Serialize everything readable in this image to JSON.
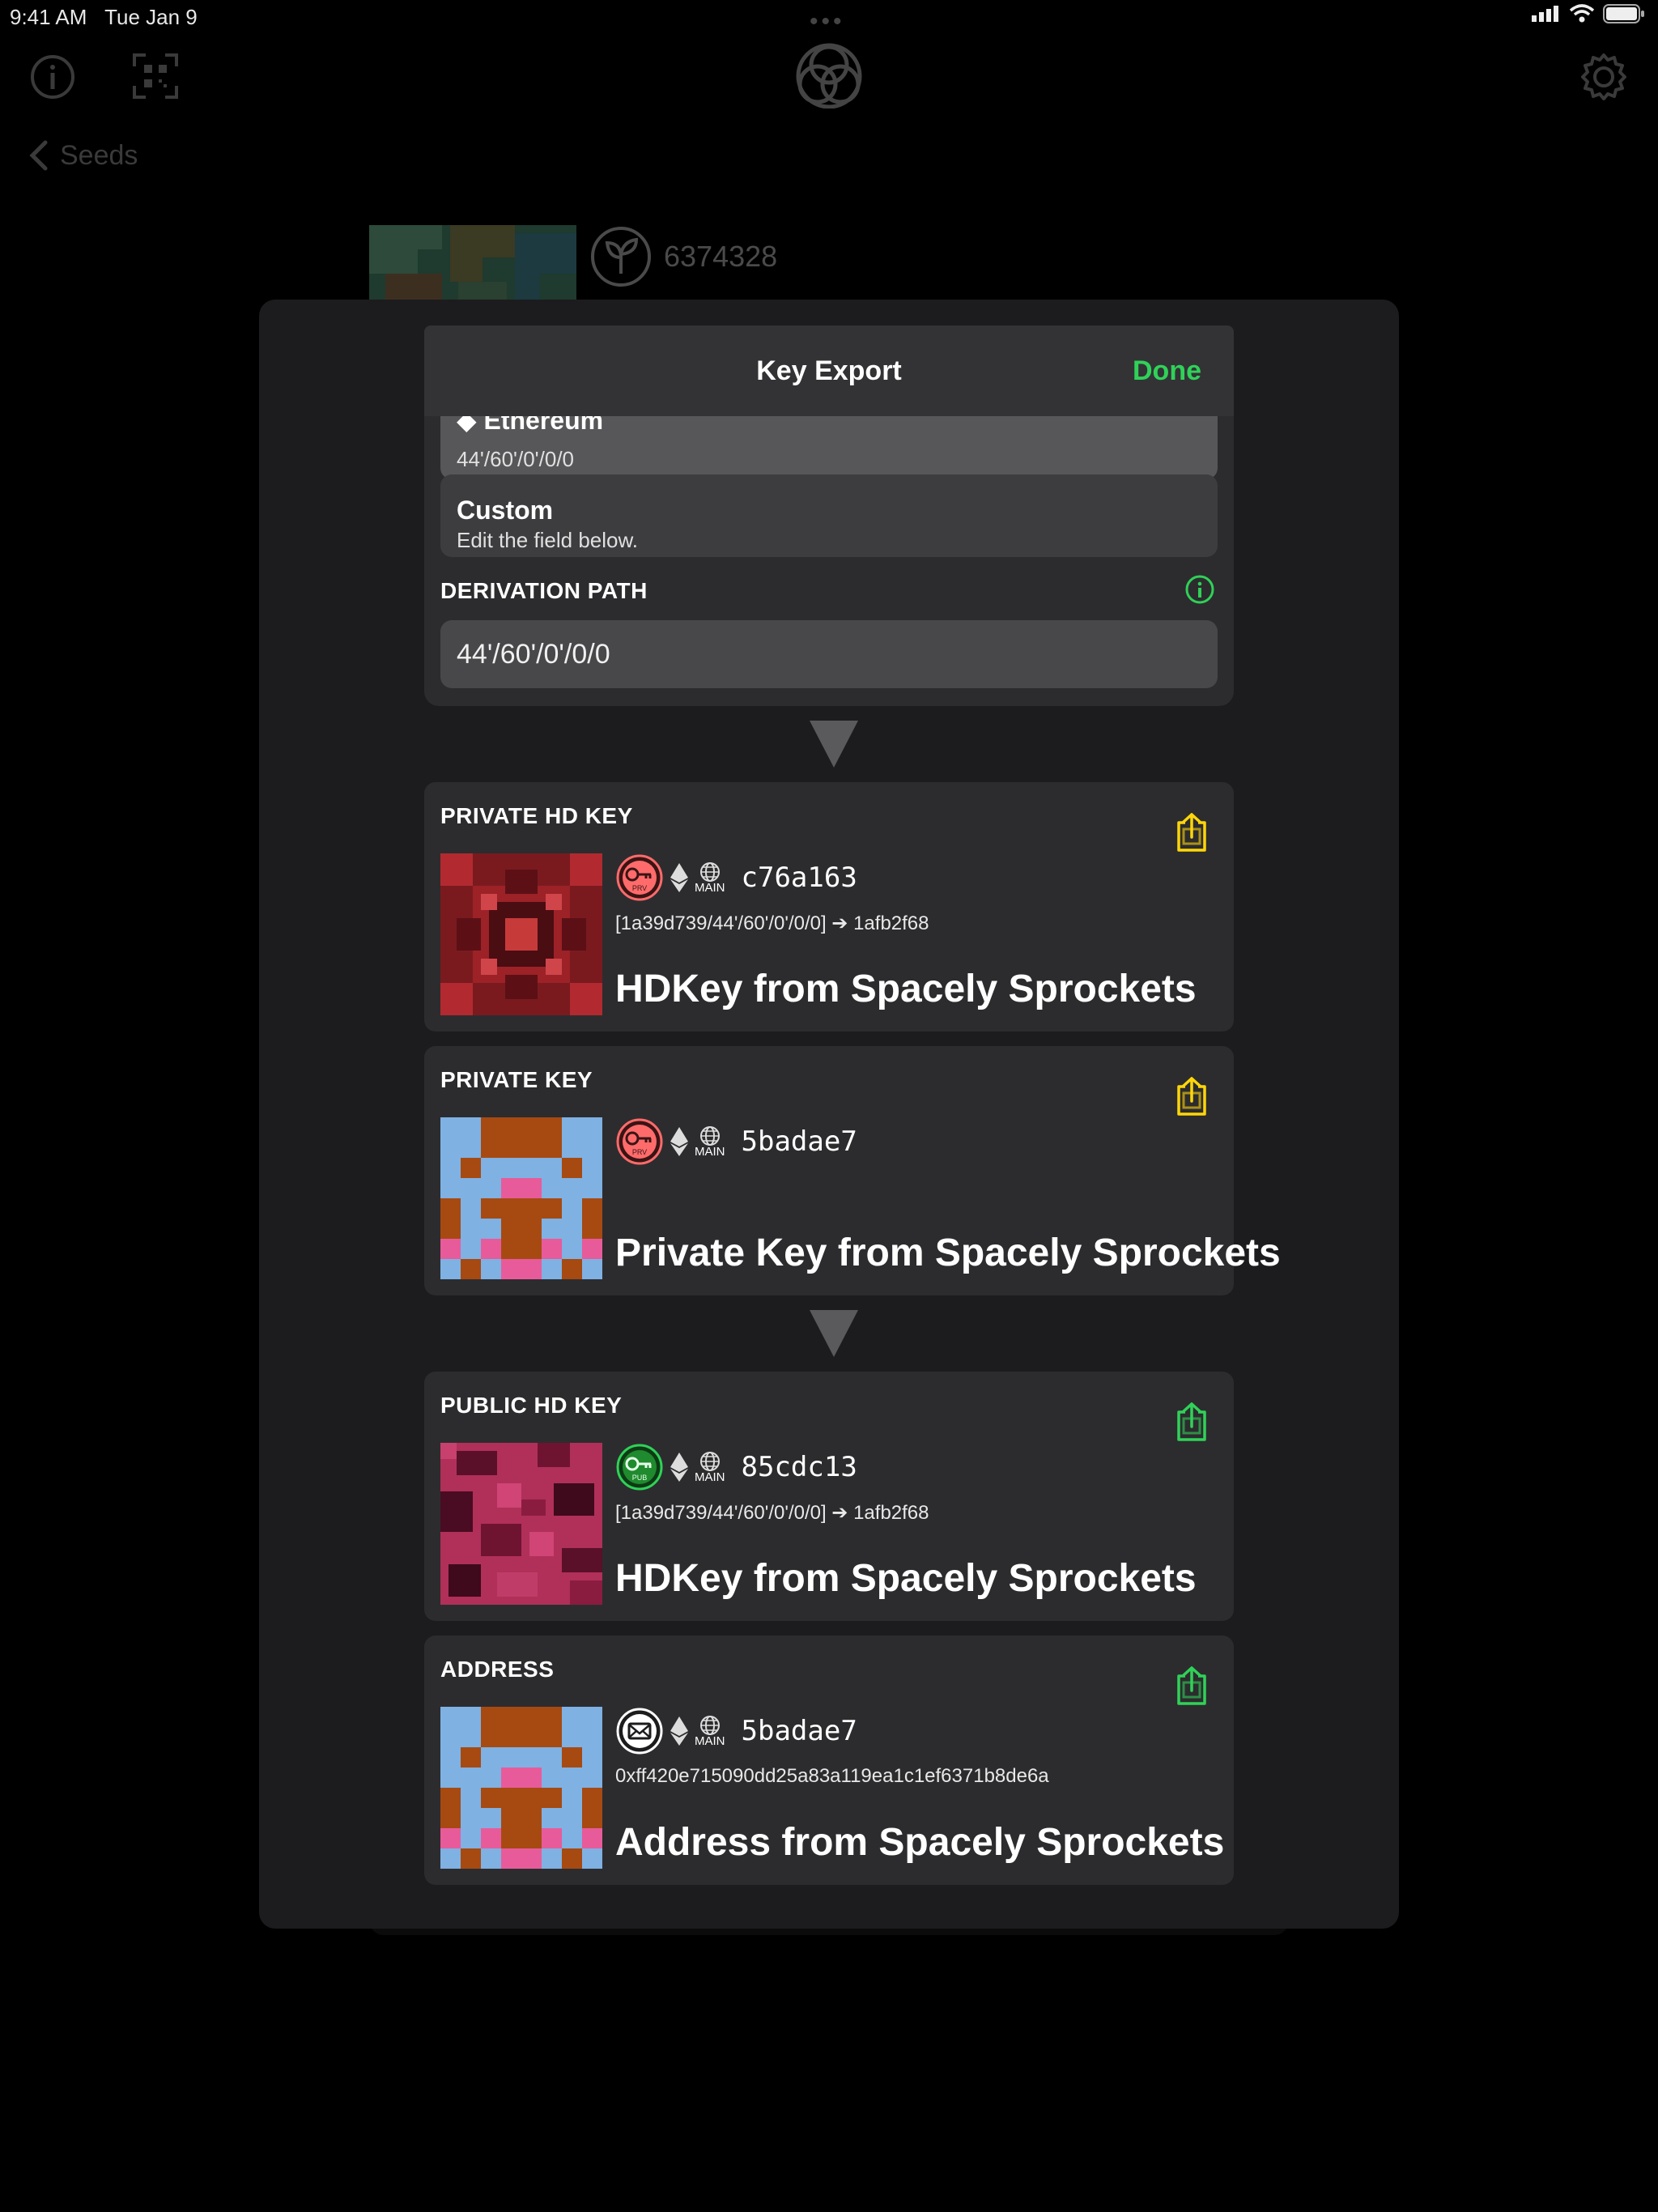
{
  "status_bar": {
    "time": "9:41 AM",
    "date": "Tue Jan 9"
  },
  "toolbar": {
    "back_label": "Seeds"
  },
  "seed": {
    "id": "6374328"
  },
  "sheet": {
    "title": "Key Export",
    "done_label": "Done",
    "options": [
      {
        "title": "Ethereum",
        "subtitle": "44'/60'/0'/0/0",
        "selected": true
      },
      {
        "title": "Custom",
        "subtitle": "Edit the field below.",
        "selected": false
      }
    ],
    "derivation_header": "DERIVATION PATH",
    "derivation_value": "44'/60'/0'/0/0"
  },
  "cards": {
    "private_hd": {
      "header": "PRIVATE HD KEY",
      "badge": "PRV",
      "network": "MAIN",
      "id": "c76a163",
      "path": "[1a39d739/44'/60'/0'/0/0] ➔ 1afb2f68",
      "name": "HDKey from Spacely Sprockets"
    },
    "private_key": {
      "header": "PRIVATE KEY",
      "badge": "PRV",
      "network": "MAIN",
      "id": "5badae7",
      "name": "Private Key from Spacely Sprockets"
    },
    "public_hd": {
      "header": "PUBLIC HD KEY",
      "badge": "PUB",
      "network": "MAIN",
      "id": "85cdc13",
      "path": "[1a39d739/44'/60'/0'/0/0] ➔ 1afb2f68",
      "name": "HDKey from Spacely Sprockets"
    },
    "address": {
      "header": "ADDRESS",
      "network": "MAIN",
      "id": "5badae7",
      "value": "0xff420e715090dd25a83a119ea1c1ef6371b8de6a",
      "name": "Address from Spacely Sprockets"
    }
  },
  "colors": {
    "accent_green": "#30d158",
    "share_yellow": "#ffd60a",
    "private_red": "#ff6b6b",
    "public_green": "#1f8a2e"
  }
}
